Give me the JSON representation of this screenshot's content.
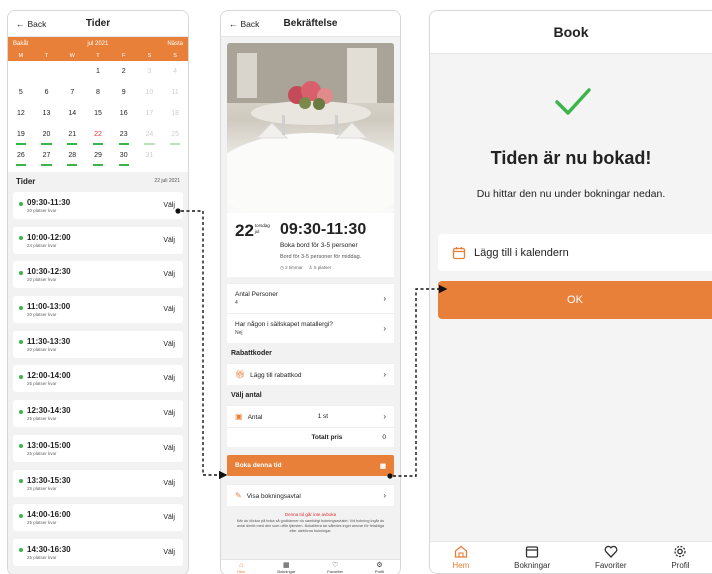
{
  "screen1": {
    "back": "Back",
    "title": "Tider",
    "calendar": {
      "prev": "Bakåt",
      "month": "jul 2021",
      "next": "Nästa",
      "weekdays": [
        "M",
        "T",
        "W",
        "T",
        "F",
        "S",
        "S"
      ],
      "weeks": [
        [
          "",
          "",
          "",
          "1",
          "2",
          "3",
          "4"
        ],
        [
          "5",
          "6",
          "7",
          "8",
          "9",
          "10",
          "11"
        ],
        [
          "12",
          "13",
          "14",
          "15",
          "16",
          "17",
          "18"
        ],
        [
          "19",
          "20",
          "21",
          "22",
          "23",
          "24",
          "25"
        ],
        [
          "26",
          "27",
          "28",
          "29",
          "30",
          "31",
          ""
        ]
      ]
    },
    "times_heading": "Tider",
    "selected_date": "22 juli 2021",
    "slots": [
      {
        "time": "09:30-11:30",
        "seats": "20 platser kvar",
        "action": "Välj"
      },
      {
        "time": "10:00-12:00",
        "seats": "24 platser kvar",
        "action": "Välj"
      },
      {
        "time": "10:30-12:30",
        "seats": "20 platser kvar",
        "action": "Välj"
      },
      {
        "time": "11:00-13:00",
        "seats": "20 platser kvar",
        "action": "Välj"
      },
      {
        "time": "11:30-13:30",
        "seats": "20 platser kvar",
        "action": "Välj"
      },
      {
        "time": "12:00-14:00",
        "seats": "25 platser kvar",
        "action": "Välj"
      },
      {
        "time": "12:30-14:30",
        "seats": "25 platser kvar",
        "action": "Välj"
      },
      {
        "time": "13:00-15:00",
        "seats": "25 platser kvar",
        "action": "Välj"
      },
      {
        "time": "13:30-15:30",
        "seats": "25 platser kvar",
        "action": "Välj"
      },
      {
        "time": "14:00-16:00",
        "seats": "25 platser kvar",
        "action": "Välj"
      },
      {
        "time": "14:30-16:30",
        "seats": "25 platser kvar",
        "action": "Välj"
      }
    ]
  },
  "screen2": {
    "back": "Back",
    "title": "Bekräftelse",
    "day": "22",
    "weekday": "torsdag",
    "month_short": "jul",
    "time": "09:30-11:30",
    "booking_title": "Boka bord för 3-5 personer",
    "booking_desc": "Bord för 3-5 personer för middag.",
    "duration": "2 timmar",
    "seats": "5 platser",
    "persons_label": "Antal Personer",
    "persons_value": "4",
    "allergy_label": "Har någon i sällskapet matallergi?",
    "allergy_value": "Nej",
    "discount_heading": "Rabattkoder",
    "discount_add": "Lägg till rabattkod",
    "quantity_heading": "Välj antal",
    "quantity_label": "Antal",
    "quantity_value": "1 st",
    "total_label": "Totalt pris",
    "total_value": "0",
    "book_button": "Boka denna tid",
    "terms_button": "Visa bokningsavtal",
    "error_text": "Denna tid går inte avboka",
    "legal_text": "När du klickar på boka så godkänner du samtidigt bokningsavtalet. Vid bokning ingår du avtal direkt med den som utför tjänsten. BokaMera tar således inget ansvar för felaktiga eller uteblivna bokningar.",
    "tabs": [
      "Hem",
      "Bokningar",
      "Favoriter",
      "Profil"
    ]
  },
  "screen3": {
    "title": "Book",
    "heading": "Tiden är nu bokad!",
    "subtext": "Du hittar den nu under bokningar nedan.",
    "calendar_button": "Lägg till i kalendern",
    "ok_button": "OK",
    "tabs": [
      "Hem",
      "Bokningar",
      "Favoriter",
      "Profil"
    ]
  },
  "colors": {
    "accent": "#e8803a",
    "available": "#3bb54a",
    "today": "#e03030",
    "success_check": "#3bb54a"
  }
}
